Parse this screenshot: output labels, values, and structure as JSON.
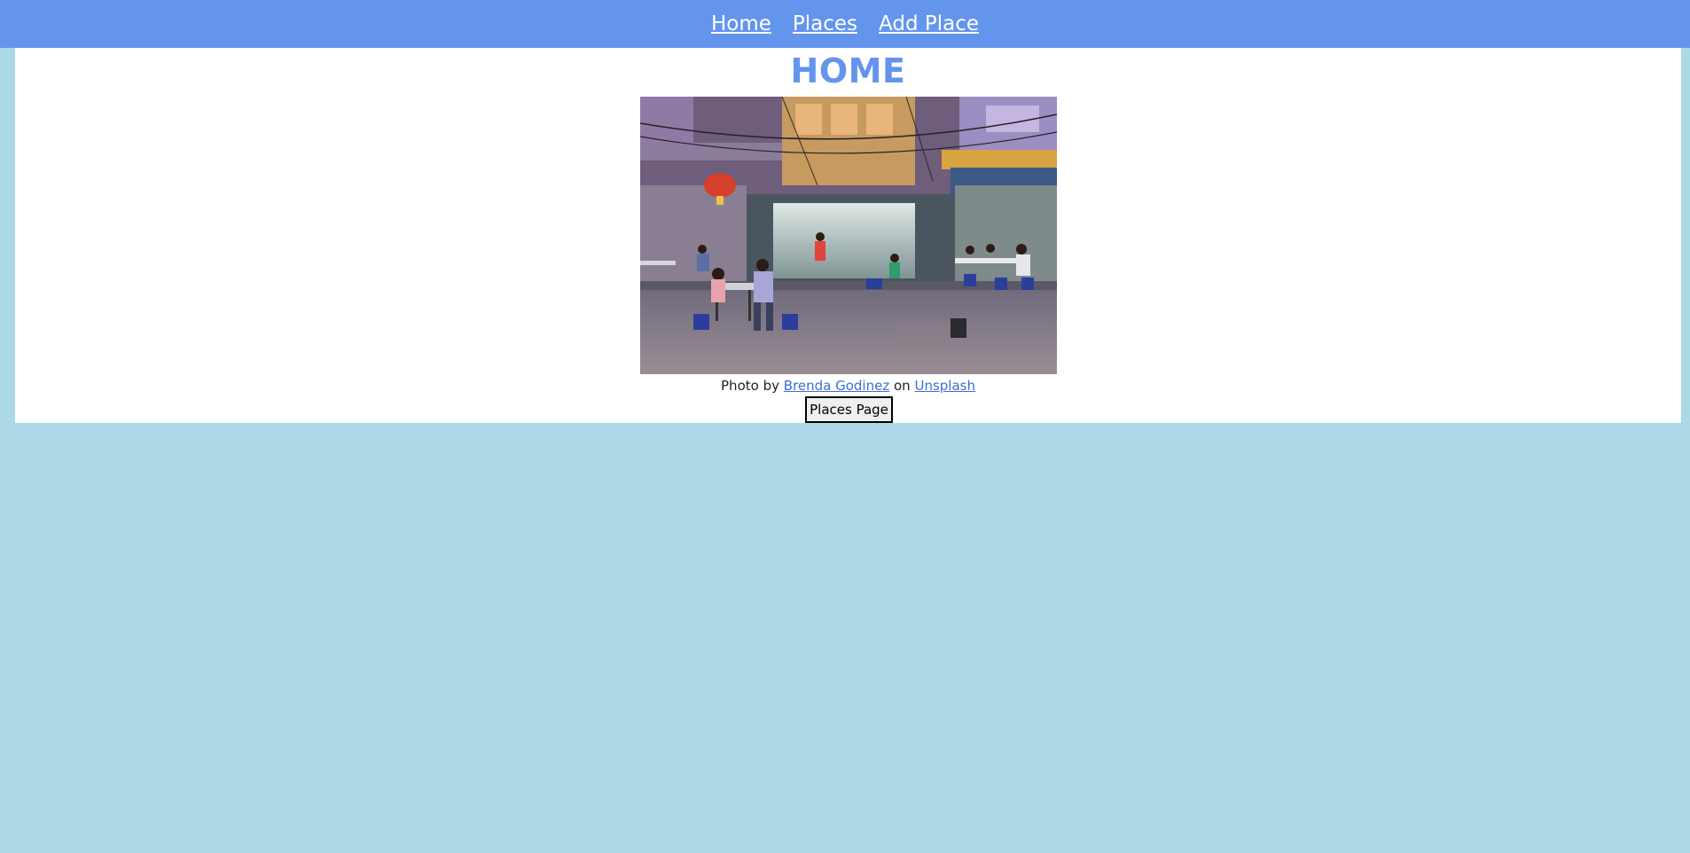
{
  "nav": {
    "links": [
      "Home",
      "Places",
      "Add Place"
    ]
  },
  "page": {
    "title": "HOME"
  },
  "photo": {
    "alt": "Night street scene with people dining at outdoor tables in front of a shop"
  },
  "credit": {
    "prefix": "Photo by",
    "author": "Brenda Godinez",
    "middle": "on",
    "site": "Unsplash"
  },
  "button": {
    "label": "Places Page"
  },
  "colors": {
    "nav_bg": "#6495ed",
    "page_bg": "#add8e6",
    "title": "#6495ed",
    "link": "#3a6fd8"
  }
}
